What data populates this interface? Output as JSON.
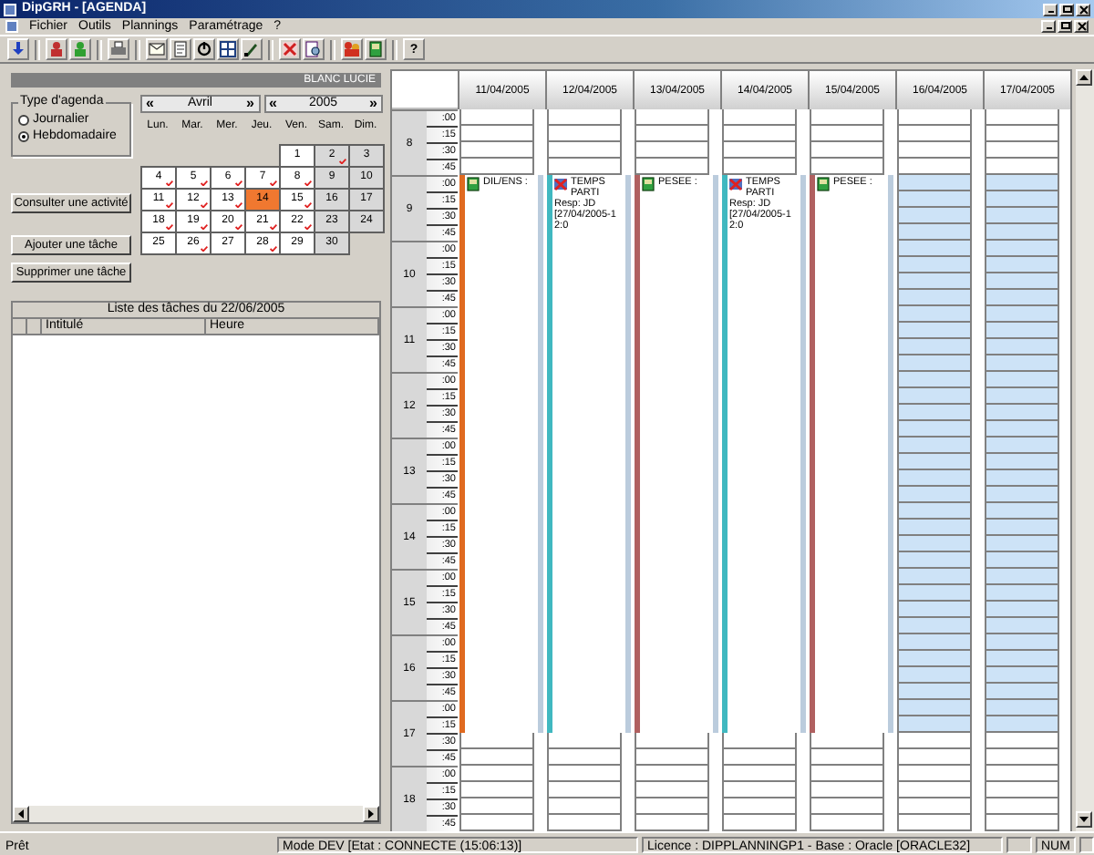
{
  "window": {
    "title": "DipGRH - [AGENDA]"
  },
  "menu": [
    "Fichier",
    "Outils",
    "Plannings",
    "Paramétrage",
    "?"
  ],
  "toolbar": [
    {
      "kind": "arrow"
    },
    {
      "kind": "sep"
    },
    {
      "kind": "person-red"
    },
    {
      "kind": "person-green"
    },
    {
      "kind": "sep"
    },
    {
      "kind": "printer"
    },
    {
      "kind": "sep"
    },
    {
      "kind": "envelope"
    },
    {
      "kind": "document"
    },
    {
      "kind": "power"
    },
    {
      "kind": "grid"
    },
    {
      "kind": "pen"
    },
    {
      "kind": "sep"
    },
    {
      "kind": "cross"
    },
    {
      "kind": "search"
    },
    {
      "kind": "sep"
    },
    {
      "kind": "people"
    },
    {
      "kind": "book"
    },
    {
      "kind": "sep"
    },
    {
      "kind": "text",
      "label": "?"
    }
  ],
  "user_name": "BLANC LUCIE",
  "agenda_type": {
    "title": "Type d'agenda",
    "options": [
      {
        "label": "Journalier",
        "selected": false
      },
      {
        "label": "Hebdomadaire",
        "selected": true
      }
    ]
  },
  "calendar": {
    "month": "Avril",
    "year": "2005",
    "prev": "«",
    "next": "»",
    "weekdays": [
      "Lun.",
      "Mar.",
      "Mer.",
      "Jeu.",
      "Ven.",
      "Sam.",
      "Dim."
    ],
    "days": [
      {
        "label": "1",
        "marked": false,
        "weekend": false,
        "selected": false
      },
      {
        "label": "2",
        "marked": true,
        "weekend": true,
        "selected": false
      },
      {
        "label": "3",
        "marked": false,
        "weekend": true,
        "selected": false
      },
      {
        "label": "4",
        "marked": true,
        "weekend": false,
        "selected": false
      },
      {
        "label": "5",
        "marked": true,
        "weekend": false,
        "selected": false
      },
      {
        "label": "6",
        "marked": true,
        "weekend": false,
        "selected": false
      },
      {
        "label": "7",
        "marked": true,
        "weekend": false,
        "selected": false
      },
      {
        "label": "8",
        "marked": true,
        "weekend": false,
        "selected": false
      },
      {
        "label": "9",
        "marked": false,
        "weekend": true,
        "selected": false
      },
      {
        "label": "10",
        "marked": false,
        "weekend": true,
        "selected": false
      },
      {
        "label": "11",
        "marked": true,
        "weekend": false,
        "selected": false
      },
      {
        "label": "12",
        "marked": true,
        "weekend": false,
        "selected": false
      },
      {
        "label": "13",
        "marked": true,
        "weekend": false,
        "selected": false
      },
      {
        "label": "14",
        "marked": false,
        "weekend": false,
        "selected": true
      },
      {
        "label": "15",
        "marked": true,
        "weekend": false,
        "selected": false
      },
      {
        "label": "16",
        "marked": false,
        "weekend": true,
        "selected": false
      },
      {
        "label": "17",
        "marked": false,
        "weekend": true,
        "selected": false
      },
      {
        "label": "18",
        "marked": true,
        "weekend": false,
        "selected": false
      },
      {
        "label": "19",
        "marked": true,
        "weekend": false,
        "selected": false
      },
      {
        "label": "20",
        "marked": true,
        "weekend": false,
        "selected": false
      },
      {
        "label": "21",
        "marked": true,
        "weekend": false,
        "selected": false
      },
      {
        "label": "22",
        "marked": true,
        "weekend": false,
        "selected": false
      },
      {
        "label": "23",
        "marked": false,
        "weekend": true,
        "selected": false
      },
      {
        "label": "24",
        "marked": false,
        "weekend": true,
        "selected": false
      },
      {
        "label": "25",
        "marked": false,
        "weekend": false,
        "selected": false
      },
      {
        "label": "26",
        "marked": true,
        "weekend": false,
        "selected": false
      },
      {
        "label": "27",
        "marked": false,
        "weekend": false,
        "selected": false
      },
      {
        "label": "28",
        "marked": true,
        "weekend": false,
        "selected": false
      },
      {
        "label": "29",
        "marked": false,
        "weekend": false,
        "selected": false
      },
      {
        "label": "30",
        "marked": false,
        "weekend": true,
        "selected": false
      }
    ]
  },
  "buttons": [
    "Consulter une activité",
    "Ajouter une tâche",
    "Supprimer une tâche"
  ],
  "task_list": {
    "title": "Liste des tâches du 22/06/2005",
    "columns": [
      "",
      "",
      "Intitulé",
      "Heure"
    ]
  },
  "agenda": {
    "days": [
      {
        "date": "11/04/2005",
        "event": {
          "kind": "book",
          "color": "#e06a20",
          "title": "DIL/ENS :"
        }
      },
      {
        "date": "12/04/2005",
        "event": {
          "kind": "cross",
          "color": "#40b8c0",
          "title": "TEMPS PARTI",
          "details": [
            "Resp: JD",
            "[27/04/2005-12:0"
          ]
        }
      },
      {
        "date": "13/04/2005",
        "event": {
          "kind": "book",
          "color": "#b06060",
          "title": "PESEE :"
        }
      },
      {
        "date": "14/04/2005",
        "event": {
          "kind": "cross",
          "color": "#40b8c0",
          "title": "TEMPS PARTI",
          "details": [
            "Resp: JD",
            "[27/04/2005-12:0"
          ]
        }
      },
      {
        "date": "15/04/2005",
        "event": {
          "kind": "book",
          "color": "#b06060",
          "title": "PESEE :"
        }
      },
      {
        "date": "16/04/2005",
        "blocked": true
      },
      {
        "date": "17/04/2005",
        "blocked": true
      }
    ],
    "hours": [
      {
        "label": "8",
        "minutes": [
          ":00",
          ":15",
          ":30",
          ":45"
        ]
      },
      {
        "label": "9",
        "minutes": [
          ":00",
          ":15",
          ":30",
          ":45"
        ]
      },
      {
        "label": "10",
        "minutes": [
          ":00",
          ":15",
          ":30",
          ":45"
        ]
      },
      {
        "label": "11",
        "minutes": [
          ":00",
          ":15",
          ":30",
          ":45"
        ]
      },
      {
        "label": "12",
        "minutes": [
          ":00",
          ":15",
          ":30",
          ":45"
        ]
      },
      {
        "label": "13",
        "minutes": [
          ":00",
          ":15",
          ":30",
          ":45"
        ]
      },
      {
        "label": "14",
        "minutes": [
          ":00",
          ":15",
          ":30",
          ":45"
        ]
      },
      {
        "label": "15",
        "minutes": [
          ":00",
          ":15",
          ":30",
          ":45"
        ]
      },
      {
        "label": "16",
        "minutes": [
          ":00",
          ":15",
          ":30",
          ":45"
        ]
      },
      {
        "label": "17",
        "minutes": [
          ":00",
          ":15",
          ":30",
          ":45"
        ]
      },
      {
        "label": "18",
        "minutes": [
          ":00",
          ":15",
          ":30",
          ":45"
        ]
      }
    ]
  },
  "status_bar": [
    "Prêt",
    "Mode DEV [Etat : CONNECTE (15:06:13)]",
    "Licence : DIPPLANNINGP1 - Base : Oracle [ORACLE32]",
    "NUM"
  ]
}
